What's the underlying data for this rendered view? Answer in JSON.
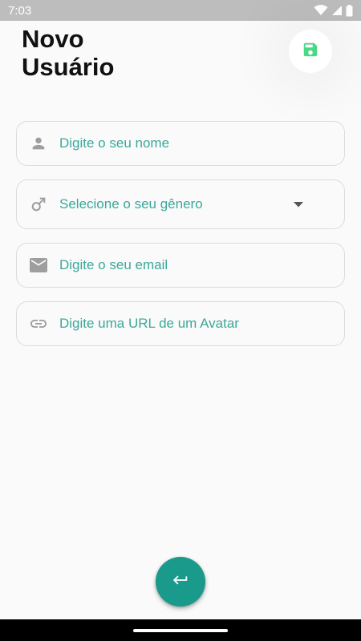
{
  "status_bar": {
    "time": "7:03",
    "icons": [
      "wifi-icon",
      "cellular-signal-icon",
      "battery-icon"
    ]
  },
  "page": {
    "title_line1": "Novo",
    "title_line2": "Usuário"
  },
  "actions": {
    "save_icon": "floppy-disk-icon",
    "return_icon": "keyboard-return-icon"
  },
  "form": {
    "name": {
      "icon": "person-icon",
      "placeholder": "Digite o seu nome",
      "value": ""
    },
    "gender": {
      "icon": "male-symbol-icon",
      "placeholder": "Selecione o seu gênero",
      "selected": ""
    },
    "email": {
      "icon": "mail-icon",
      "placeholder": "Digite o seu email",
      "value": ""
    },
    "avatar": {
      "icon": "link-icon",
      "placeholder": "Digite uma URL de um Avatar",
      "value": ""
    }
  },
  "colors": {
    "accent": "#1a9a8a",
    "placeholder": "#3aa89a",
    "save_icon": "#4cd787",
    "field_icon": "#9e9e9e",
    "status_bar": "#bdbdbd"
  }
}
